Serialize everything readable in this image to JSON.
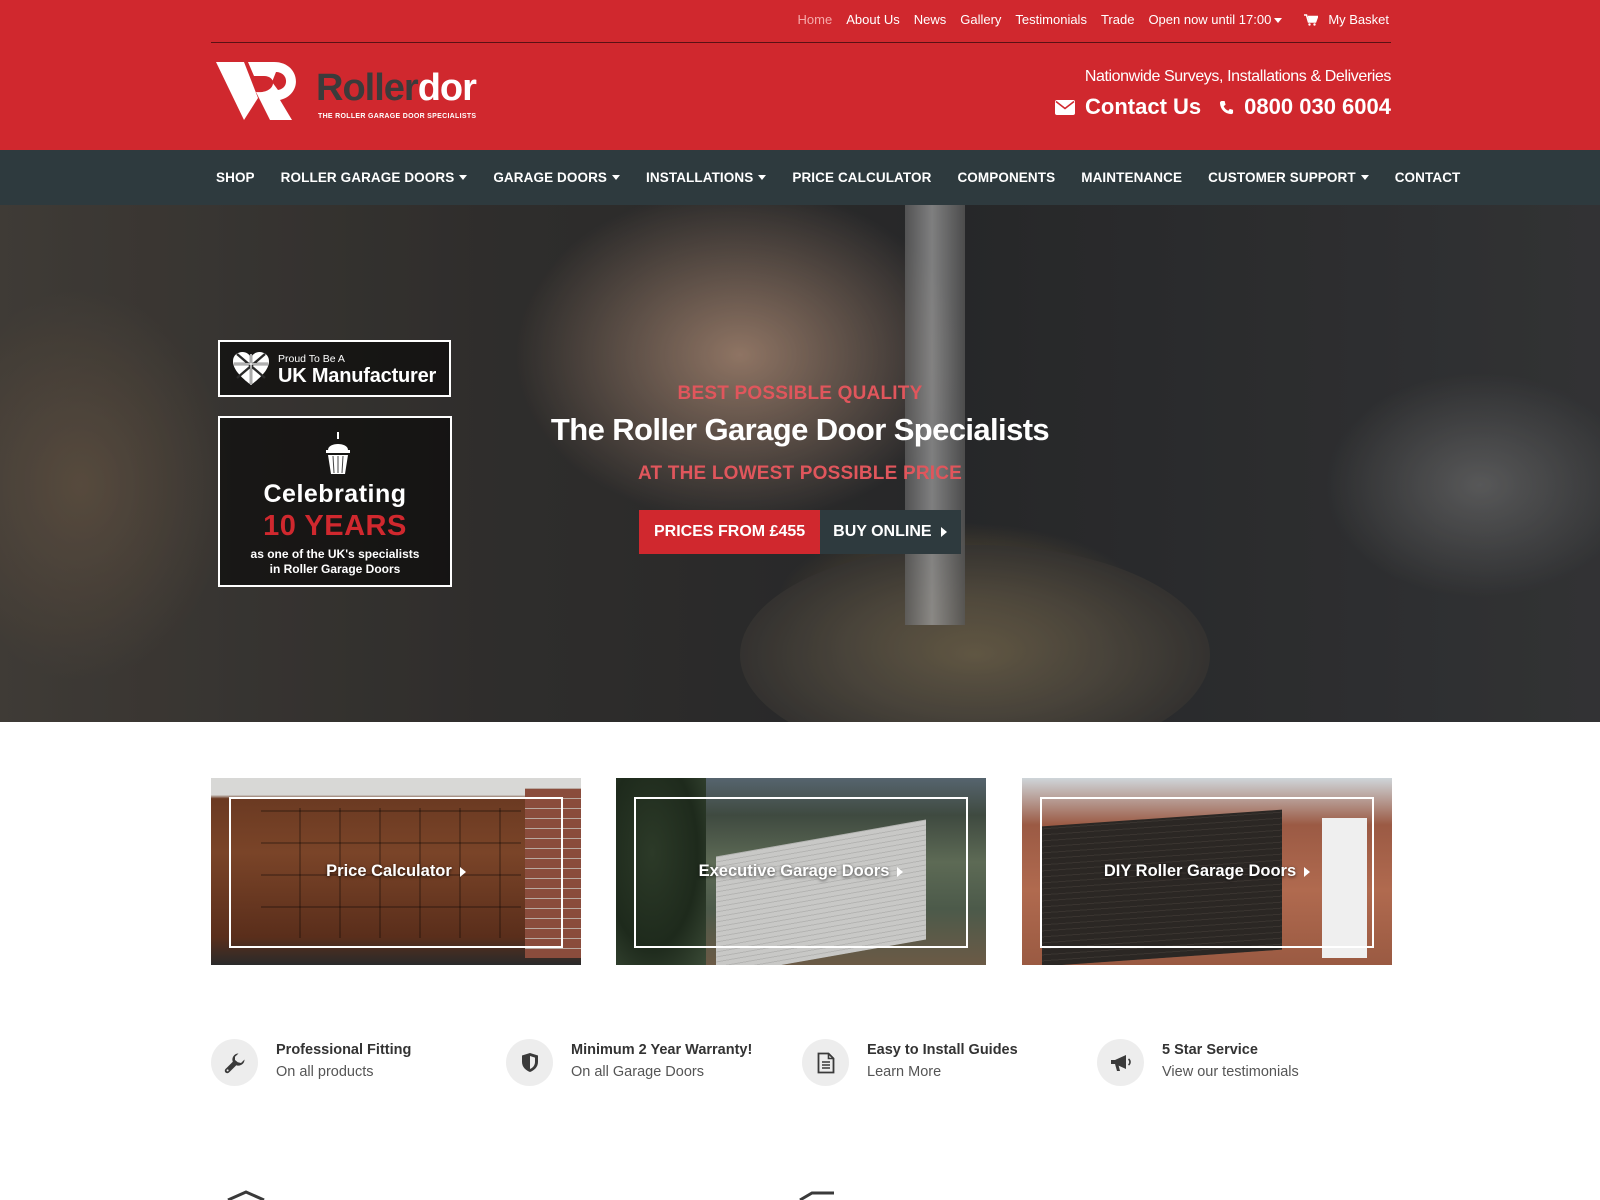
{
  "top_nav": {
    "links": [
      "Home",
      "About Us",
      "News",
      "Gallery",
      "Testimonials",
      "Trade"
    ],
    "hours": "Open now until 17:00",
    "basket": "My Basket"
  },
  "logo": {
    "word_part1": "Roller",
    "word_part2": "dor",
    "tagline": "THE ROLLER GARAGE DOOR SPECIALISTS"
  },
  "header": {
    "survey_text": "Nationwide Surveys, Installations & Deliveries",
    "contact_label": "Contact Us",
    "phone": "0800 030 6004"
  },
  "main_nav": {
    "items": [
      "SHOP",
      "ROLLER GARAGE DOORS",
      "GARAGE DOORS",
      "INSTALLATIONS",
      "PRICE CALCULATOR",
      "COMPONENTS",
      "MAINTENANCE",
      "CUSTOMER SUPPORT",
      "CONTACT"
    ]
  },
  "hero": {
    "badge_small": "Proud To Be A",
    "badge_big": "UK Manufacturer",
    "years_line1": "Celebrating",
    "years_line2": "10 YEARS",
    "years_desc1": "as one of the UK's specialists",
    "years_desc2": "in Roller Garage Doors",
    "kicker": "BEST POSSIBLE QUALITY",
    "headline": "The Roller Garage Door Specialists",
    "subline": "AT THE LOWEST POSSIBLE PRICE",
    "price_button": "PRICES FROM £455",
    "buy_button": "BUY ONLINE"
  },
  "tiles": [
    {
      "label": "Price Calculator"
    },
    {
      "label": "Executive Garage Doors"
    },
    {
      "label": "DIY Roller Garage Doors"
    }
  ],
  "features": [
    {
      "title": "Professional Fitting",
      "sub": "On all products",
      "icon": "wrench-icon"
    },
    {
      "title": "Minimum 2 Year Warranty!",
      "sub": "On all Garage Doors",
      "icon": "shield-icon"
    },
    {
      "title": "Easy to Install Guides",
      "sub": "Learn More",
      "icon": "document-icon"
    },
    {
      "title": "5 Star Service",
      "sub": "View our testimonials",
      "icon": "megaphone-icon"
    }
  ],
  "colors": {
    "brand_red": "#d0282e",
    "nav_dark": "#2e3a3e",
    "accent_pink": "#e0565c"
  }
}
